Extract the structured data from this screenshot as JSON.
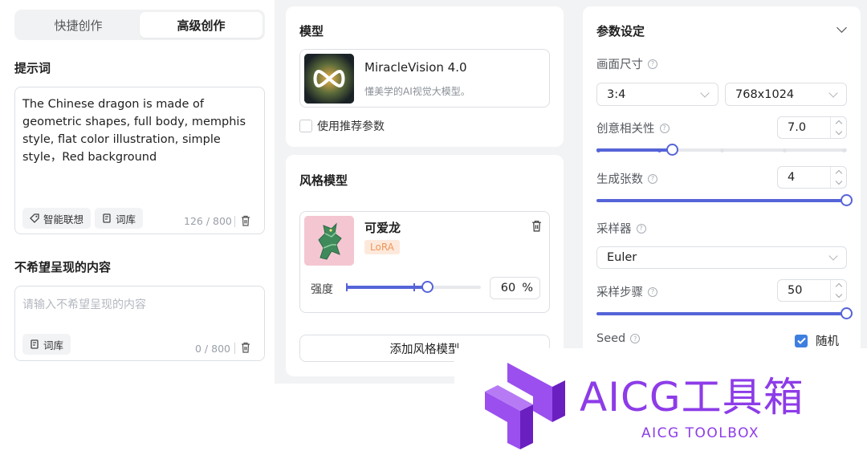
{
  "tabs": {
    "quick": "快捷创作",
    "advanced": "高级创作"
  },
  "prompt": {
    "title": "提示词",
    "text": "The Chinese dragon is made of geometric shapes, full body, memphis style, flat color illustration, simple style，Red background",
    "smart_label": "智能联想",
    "lexicon_label": "词库",
    "counter": "126 / 800"
  },
  "negative": {
    "title": "不希望呈现的内容",
    "placeholder": "请输入不希望呈现的内容",
    "lexicon_label": "词库",
    "counter": "0 / 800"
  },
  "model": {
    "title": "模型",
    "name": "MiracleVision 4.0",
    "desc": "懂美学的AI视觉大模型。",
    "use_recommended": "使用推荐参数",
    "use_recommended_checked": false
  },
  "style": {
    "title": "风格模型",
    "item_name": "可爱龙",
    "badge": "LoRA",
    "strength_label": "强度",
    "strength_value": "60",
    "strength_unit": "%",
    "strength_fraction": 0.6,
    "add_button": "添加风格模型"
  },
  "params": {
    "title": "参数设定",
    "size_label": "画面尺寸",
    "ratio": "3:4",
    "resolution": "768x1024",
    "creativity_label": "创意相关性",
    "creativity_value": "7.0",
    "creativity_fraction": 0.3,
    "count_label": "生成张数",
    "count_value": "4",
    "count_fraction": 1.0,
    "sampler_label": "采样器",
    "sampler_value": "Euler",
    "steps_label": "采样步骤",
    "steps_value": "50",
    "steps_fraction": 1.0,
    "seed_label": "Seed",
    "random_label": "随机",
    "random_checked": true
  },
  "watermark": {
    "title": "AICG工具箱",
    "subtitle": "AICG TOOLBOX"
  },
  "colors": {
    "accent": "#5564d8",
    "checkbox": "#3d7fe0",
    "lora_bg": "#fde9dc",
    "lora_text": "#f0965a",
    "watermark": "#8d3ce8"
  }
}
